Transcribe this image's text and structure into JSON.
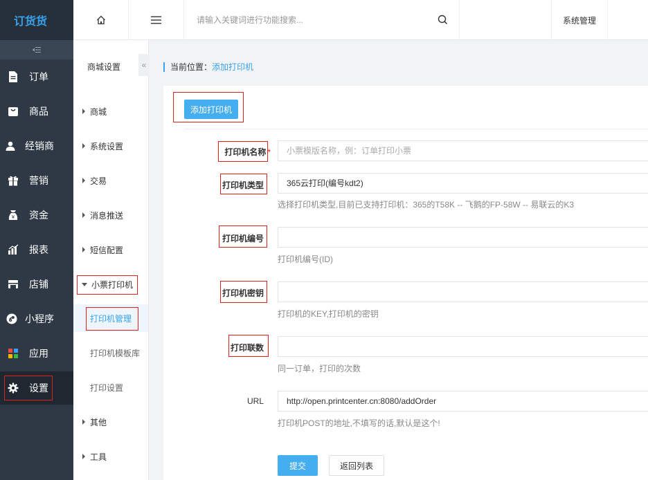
{
  "app": {
    "logo_text": "订货货"
  },
  "sidebar": {
    "collapse_icon": "collapse-icon",
    "items": [
      {
        "label": "订单",
        "icon": "document-icon"
      },
      {
        "label": "商品",
        "icon": "bag-icon"
      },
      {
        "label": "经销商",
        "icon": "user-icon"
      },
      {
        "label": "营销",
        "icon": "gift-icon"
      },
      {
        "label": "资金",
        "icon": "money-icon"
      },
      {
        "label": "报表",
        "icon": "bar-chart-icon"
      },
      {
        "label": "店铺",
        "icon": "store-icon"
      },
      {
        "label": "小程序",
        "icon": "miniprogram-icon"
      },
      {
        "label": "应用",
        "icon": "apps-icon"
      },
      {
        "label": "设置",
        "icon": "gear-icon",
        "active": true
      }
    ]
  },
  "topbar": {
    "home_icon": "home-icon",
    "menu_icon": "hamburger-icon",
    "search_placeholder": "请输入关键词进行功能搜索...",
    "search_icon": "search-icon",
    "system_management": "系统管理"
  },
  "submenu": {
    "title": "商城设置",
    "collapse_icon": "double-chevron-left-icon",
    "items": [
      {
        "label": "商城"
      },
      {
        "label": "系统设置"
      },
      {
        "label": "交易"
      },
      {
        "label": "消息推送"
      },
      {
        "label": "短信配置"
      },
      {
        "label": "小票打印机",
        "expanded": true
      }
    ],
    "sub_items": [
      {
        "label": "打印机管理",
        "active": true
      },
      {
        "label": "打印机模板库"
      },
      {
        "label": "打印设置"
      }
    ],
    "tail_items": [
      {
        "label": "其他"
      },
      {
        "label": "工具"
      }
    ]
  },
  "breadcrumb": {
    "prefix": "当前位置：",
    "current": "添加打印机"
  },
  "form": {
    "add_button": "添加打印机",
    "fields": {
      "name": {
        "label": "打印机名称",
        "required_mark": "*",
        "placeholder": "小票模版名称，例：订单打印小票",
        "value": ""
      },
      "type": {
        "label": "打印机类型",
        "value": "365云打印(编号kdt2)",
        "hint": "选择打印机类型,目前已支持打印机：365的T58K -- 飞鹅的FP-58W -- 易联云的K3"
      },
      "number": {
        "label": "打印机编号",
        "value": "",
        "hint": "打印机编号(ID)"
      },
      "key": {
        "label": "打印机密钥",
        "value": "",
        "hint": "打印机的KEY,打印机的密钥"
      },
      "copies": {
        "label": "打印联数",
        "value": "",
        "hint": "同一订单，打印的次数"
      },
      "url": {
        "label": "URL",
        "value": "http://open.printcenter.cn:8080/addOrder",
        "hint": "打印机POST的地址,不填写的话,默认是这个!"
      }
    },
    "submit_button": "提交",
    "back_button": "返回列表"
  },
  "colors": {
    "sidebar_bg": "#2f3946",
    "accent": "#38a2ee",
    "primary_button": "#45aef0",
    "highlight_border": "#e02020"
  }
}
